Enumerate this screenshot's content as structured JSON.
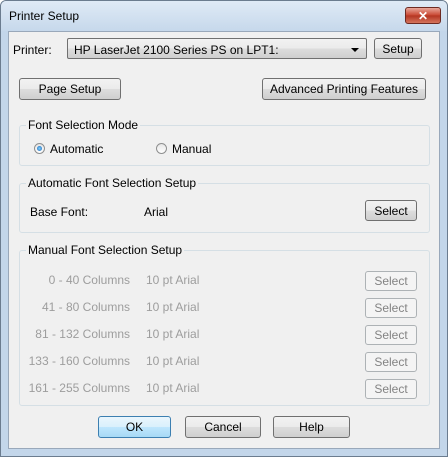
{
  "window": {
    "title": "Printer Setup",
    "close_label": "✕"
  },
  "printer": {
    "label": "Printer:",
    "selected": "HP LaserJet 2100 Series PS on LPT1:",
    "setup_button": "Setup"
  },
  "buttons": {
    "page_setup": "Page Setup",
    "advanced": "Advanced Printing Features",
    "ok": "OK",
    "cancel": "Cancel",
    "help": "Help"
  },
  "font_mode": {
    "title": "Font Selection Mode",
    "automatic": "Automatic",
    "manual": "Manual",
    "selected": "Automatic"
  },
  "auto_setup": {
    "title": "Automatic Font Selection Setup",
    "base_label": "Base Font:",
    "base_value": "Arial",
    "select_button": "Select"
  },
  "manual_setup": {
    "title": "Manual Font Selection Setup",
    "rows": [
      {
        "range": "0 - 40 Columns",
        "font": "10 pt Arial",
        "button": "Select"
      },
      {
        "range": "41 - 80 Columns",
        "font": "10 pt Arial",
        "button": "Select"
      },
      {
        "range": "81 - 132 Columns",
        "font": "10 pt Arial",
        "button": "Select"
      },
      {
        "range": "133 - 160 Columns",
        "font": "10 pt Arial",
        "button": "Select"
      },
      {
        "range": "161 - 255 Columns",
        "font": "10 pt Arial",
        "button": "Select"
      }
    ]
  }
}
